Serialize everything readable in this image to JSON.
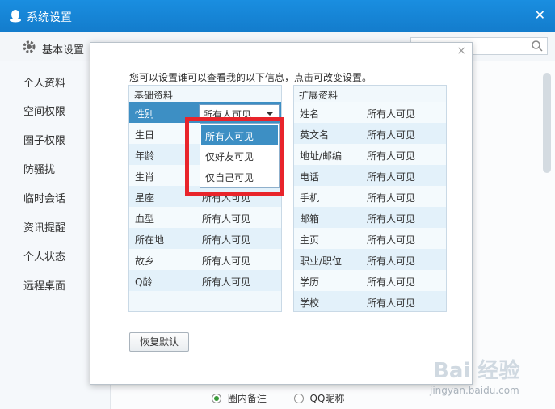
{
  "window": {
    "title": "系统设置",
    "close": "✕"
  },
  "topbar": {
    "section_label": "基本设置"
  },
  "sidebar": {
    "items": [
      {
        "label": "个人资料"
      },
      {
        "label": "空间权限"
      },
      {
        "label": "圈子权限"
      },
      {
        "label": "防骚扰"
      },
      {
        "label": "临时会话"
      },
      {
        "label": "资讯提醒"
      },
      {
        "label": "个人状态"
      },
      {
        "label": "远程桌面"
      }
    ]
  },
  "bottom_radios": [
    {
      "label": "圈内备注",
      "checked": true
    },
    {
      "label": "QQ昵称",
      "checked": false
    }
  ],
  "dialog": {
    "close": "×",
    "hint": "您可以设置谁可以查看我的以下信息，点击可改变设置。",
    "basic": {
      "header": "基础资料",
      "selected": {
        "key": "性别",
        "value": "所有人可见"
      },
      "rows": [
        {
          "key": "生日",
          "value": ""
        },
        {
          "key": "年龄",
          "value": ""
        },
        {
          "key": "生肖",
          "value": ""
        },
        {
          "key": "星座",
          "value": "所有人可见"
        },
        {
          "key": "血型",
          "value": "所有人可见"
        },
        {
          "key": "所在地",
          "value": "所有人可见"
        },
        {
          "key": "故乡",
          "value": "所有人可见"
        },
        {
          "key": "Q龄",
          "value": "所有人可见"
        }
      ]
    },
    "extended": {
      "header": "扩展资料",
      "rows": [
        {
          "key": "姓名",
          "value": "所有人可见"
        },
        {
          "key": "英文名",
          "value": "所有人可见"
        },
        {
          "key": "地址/邮编",
          "value": "所有人可见"
        },
        {
          "key": "电话",
          "value": "所有人可见"
        },
        {
          "key": "手机",
          "value": "所有人可见"
        },
        {
          "key": "邮箱",
          "value": "所有人可见"
        },
        {
          "key": "主页",
          "value": "所有人可见"
        },
        {
          "key": "职业/职位",
          "value": "所有人可见"
        },
        {
          "key": "学历",
          "value": "所有人可见"
        },
        {
          "key": "学校",
          "value": "所有人可见"
        }
      ]
    },
    "dropdown_options": [
      {
        "label": "所有人可见",
        "active": true
      },
      {
        "label": "仅好友可见",
        "active": false
      },
      {
        "label": "仅自己可见",
        "active": false
      }
    ],
    "reset_label": "恢复默认"
  },
  "colors": {
    "accent": "#3d8fc4",
    "highlight": "#e8242b",
    "titlebar": "#1a8ee0"
  },
  "watermark": {
    "brand": "Bai 经验",
    "url": "jingyan.baidu.com"
  }
}
